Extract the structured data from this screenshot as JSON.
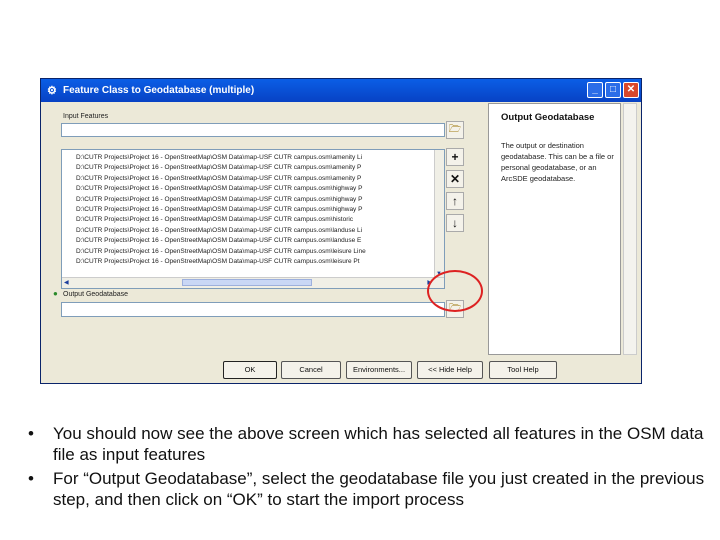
{
  "window": {
    "title": "Feature Class to Geodatabase (multiple)",
    "app_icon": "geoprocessing-tool-icon",
    "controls": {
      "minimize": "_",
      "maximize": "□",
      "close": "✕"
    }
  },
  "form": {
    "input_features_label": "Input Features",
    "input_features_value": "",
    "list_items": [
      "D:\\CUTR Projects\\Project 16 - OpenStreetMap\\OSM Data\\map-USF CUTR campus.osm\\amenity Li",
      "D:\\CUTR Projects\\Project 16 - OpenStreetMap\\OSM Data\\map-USF CUTR campus.osm\\amenity P",
      "D:\\CUTR Projects\\Project 16 - OpenStreetMap\\OSM Data\\map-USF CUTR campus.osm\\amenity P",
      "D:\\CUTR Projects\\Project 16 - OpenStreetMap\\OSM Data\\map-USF CUTR campus.osm\\highway P",
      "D:\\CUTR Projects\\Project 16 - OpenStreetMap\\OSM Data\\map-USF CUTR campus.osm\\highway P",
      "D:\\CUTR Projects\\Project 16 - OpenStreetMap\\OSM Data\\map-USF CUTR campus.osm\\highway P",
      "D:\\CUTR Projects\\Project 16 - OpenStreetMap\\OSM Data\\map-USF CUTR campus.osm\\historic",
      "D:\\CUTR Projects\\Project 16 - OpenStreetMap\\OSM Data\\map-USF CUTR campus.osm\\landuse Li",
      "D:\\CUTR Projects\\Project 16 - OpenStreetMap\\OSM Data\\map-USF CUTR campus.osm\\landuse E",
      "D:\\CUTR Projects\\Project 16 - OpenStreetMap\\OSM Data\\map-USF CUTR campus.osm\\leisure Line",
      "D:\\CUTR Projects\\Project 16 - OpenStreetMap\\OSM Data\\map-USF CUTR campus.osm\\leisure Pt"
    ],
    "output_gdb_label": "Output Geodatabase",
    "output_gdb_value": ""
  },
  "side_buttons": {
    "add": "+",
    "remove": "✕",
    "up": "↑",
    "down": "↓"
  },
  "help": {
    "title": "Output Geodatabase",
    "text": "The output or destination geodatabase. This can be a file or personal geodatabase, or an ArcSDE geodatabase."
  },
  "buttons": {
    "ok": "OK",
    "cancel": "Cancel",
    "environments": "Environments...",
    "hide_help": "<< Hide Help",
    "tool_help": "Tool Help"
  },
  "instructions": [
    "You should now see the above screen which has selected all features in the OSM data file as input features",
    "For “Output Geodatabase”, select the geodatabase file you just created in the previous step, and then click on “OK” to start the import process"
  ],
  "bullet": "•",
  "colors": {
    "highlight_ring": "#dd2222",
    "titlebar": "#0a5ee6"
  }
}
